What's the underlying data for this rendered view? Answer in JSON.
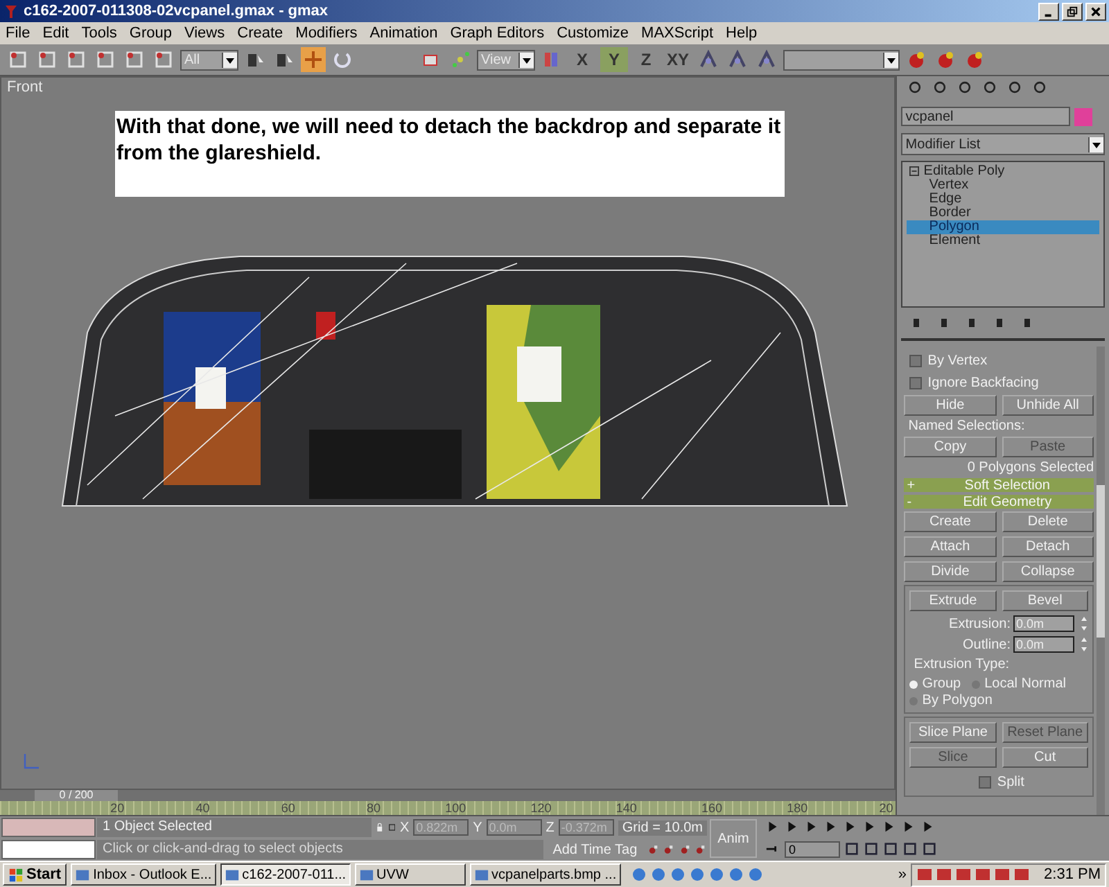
{
  "window": {
    "title": "c162-2007-011308-02vcpanel.gmax - gmax"
  },
  "menu": [
    {
      "label": "File"
    },
    {
      "label": "Edit"
    },
    {
      "label": "Tools"
    },
    {
      "label": "Group"
    },
    {
      "label": "Views"
    },
    {
      "label": "Create"
    },
    {
      "label": "Modifiers"
    },
    {
      "label": "Animation"
    },
    {
      "label": "Graph Editors"
    },
    {
      "label": "Customize"
    },
    {
      "label": "MAXScript"
    },
    {
      "label": "Help"
    }
  ],
  "toolbar": {
    "selection_filter": "All",
    "reference_coord": "View",
    "transform_tools": [
      {
        "kind": "move",
        "selected": true
      },
      {
        "kind": "rotate",
        "selected": false
      }
    ],
    "axis_constraints": [
      {
        "label": "X",
        "selected": false
      },
      {
        "label": "Y",
        "selected": true
      },
      {
        "label": "Z",
        "selected": false
      },
      {
        "label": "XY",
        "selected": false
      }
    ]
  },
  "viewport": {
    "label": "Front",
    "note": "With that done, we will need to detach the backdrop and separate it from the glareshield."
  },
  "command_panel": {
    "object_name": "vcpanel",
    "modifier_list": "Modifier List",
    "stack": [
      {
        "label": "Editable Poly",
        "selected": false,
        "children": [
          {
            "label": "Vertex",
            "selected": false
          },
          {
            "label": "Edge",
            "selected": false
          },
          {
            "label": "Border",
            "selected": false
          },
          {
            "label": "Polygon",
            "selected": true
          },
          {
            "label": "Element",
            "selected": false
          }
        ]
      }
    ],
    "selection": {
      "checkboxes": [
        {
          "label": "By Vertex",
          "checked": false
        },
        {
          "label": "Ignore Backfacing",
          "checked": false
        }
      ],
      "buttons": [
        {
          "label": "Hide",
          "disabled": false
        },
        {
          "label": "Unhide All",
          "disabled": false
        }
      ],
      "named_selections_label": "Named Selections:",
      "named_buttons": [
        {
          "label": "Copy",
          "disabled": false
        },
        {
          "label": "Paste",
          "disabled": true
        }
      ],
      "status": "0 Polygons Selected"
    },
    "rollouts": [
      {
        "sign": "+",
        "title": "Soft Selection"
      },
      {
        "sign": "-",
        "title": "Edit Geometry"
      }
    ],
    "edit_geometry": {
      "buttons": [
        {
          "label": "Create",
          "disabled": false
        },
        {
          "label": "Delete",
          "disabled": false
        },
        {
          "label": "Attach",
          "disabled": false
        },
        {
          "label": "Detach",
          "disabled": false
        },
        {
          "label": "Divide",
          "disabled": false
        },
        {
          "label": "Collapse",
          "disabled": false
        }
      ],
      "extrude_buttons": [
        {
          "label": "Extrude",
          "disabled": false
        },
        {
          "label": "Bevel",
          "disabled": false
        }
      ],
      "spinners": [
        {
          "label": "Extrusion:",
          "value": "0.0m"
        },
        {
          "label": "Outline:",
          "value": "0.0m"
        }
      ],
      "extrusion_type_label": "Extrusion Type:",
      "radios": [
        {
          "label": "Group",
          "selected": true
        },
        {
          "label": "Local Normal",
          "selected": false
        },
        {
          "label": "By Polygon",
          "selected": false
        }
      ],
      "slice_buttons": [
        {
          "label": "Slice Plane",
          "disabled": false
        },
        {
          "label": "Reset Plane",
          "disabled": true
        },
        {
          "label": "Slice",
          "disabled": true
        },
        {
          "label": "Cut",
          "disabled": false
        }
      ],
      "split": {
        "label": "Split",
        "checked": false
      }
    }
  },
  "timeline": {
    "slider": "0 / 200",
    "level": 0,
    "ticks": [
      "20",
      "40",
      "60",
      "80",
      "100",
      "120",
      "140",
      "160",
      "180",
      "20"
    ]
  },
  "status": {
    "selection": "1 Object Selected",
    "prompt": "Click or click-and-drag to select objects",
    "coords": [
      {
        "label": "X",
        "value": "0.822m"
      },
      {
        "label": "Y",
        "value": "0.0m"
      },
      {
        "label": "Z",
        "value": "-0.372m"
      }
    ],
    "grid": "Grid = 10.0m",
    "time_tag": "Add Time Tag",
    "anim": "Anim",
    "frame": "0"
  },
  "taskbar": {
    "start": "Start",
    "tasks": [
      {
        "label": "Inbox - Outlook E...",
        "selected": false
      },
      {
        "label": "c162-2007-011...",
        "selected": true
      },
      {
        "label": "UVW",
        "selected": false
      },
      {
        "label": "vcpanelparts.bmp ...",
        "selected": false
      }
    ],
    "overflow": "»",
    "clock": "2:31 PM"
  }
}
